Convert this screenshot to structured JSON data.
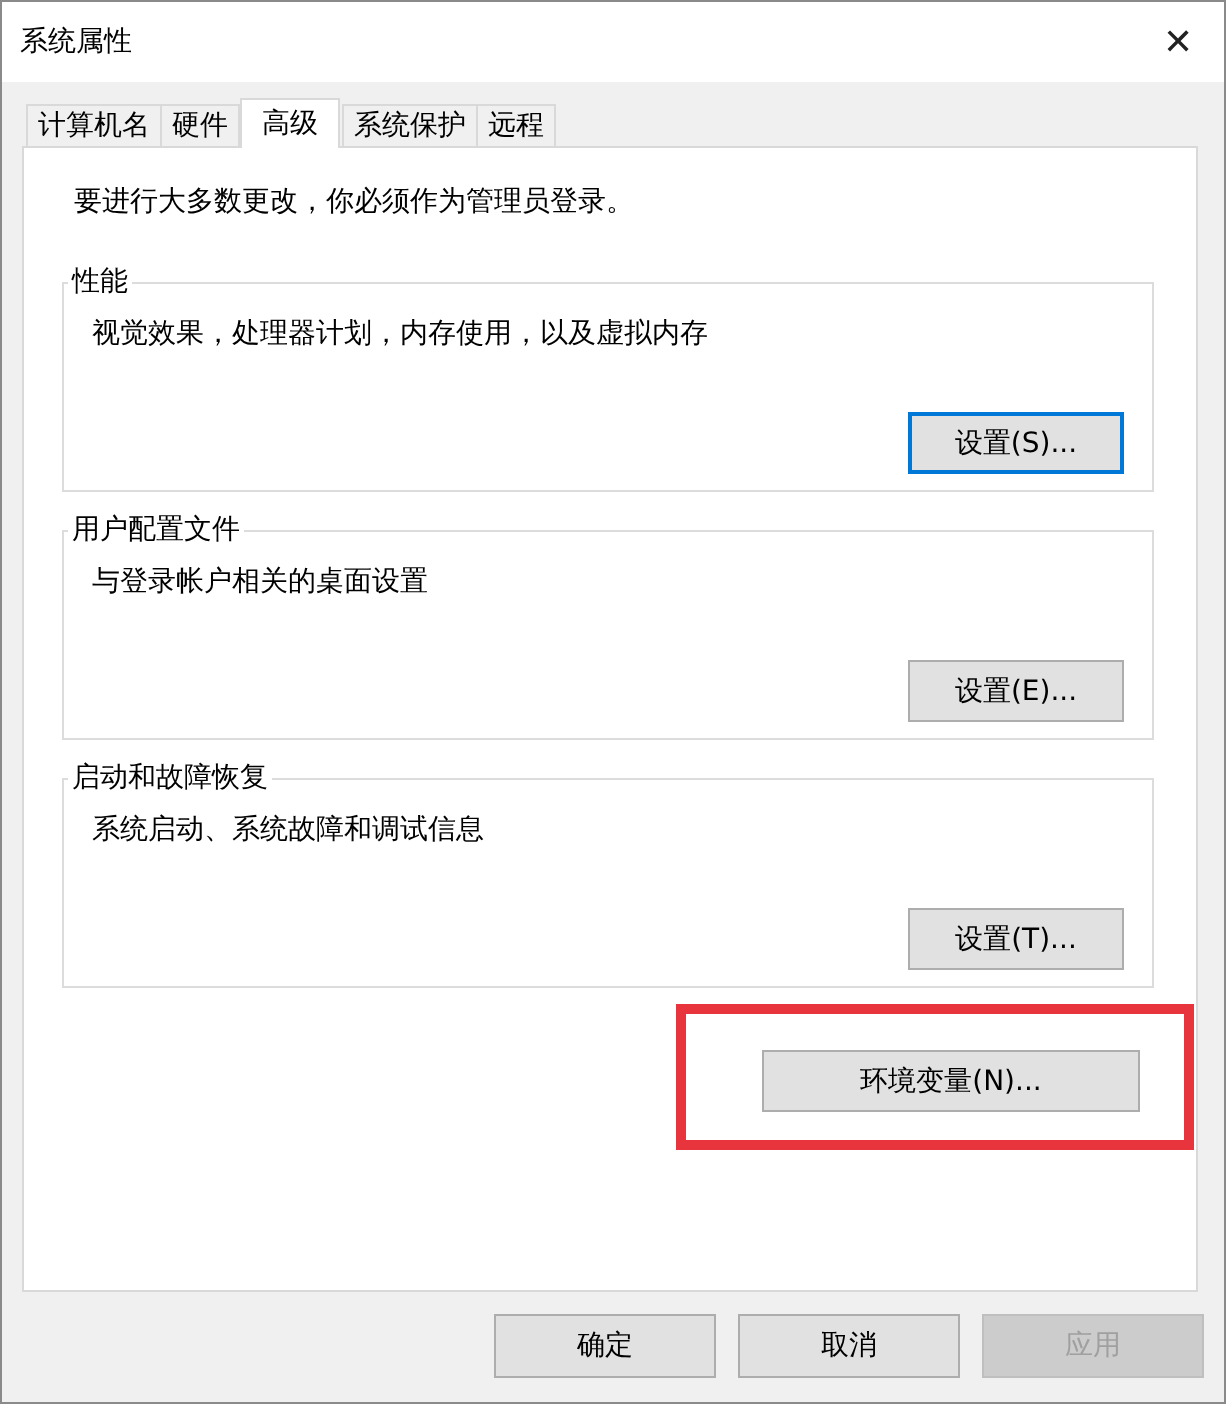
{
  "window": {
    "title": "系统属性",
    "close": "✕"
  },
  "tabs": [
    {
      "label": "计算机名",
      "selected": false
    },
    {
      "label": "硬件",
      "selected": false
    },
    {
      "label": "高级",
      "selected": true
    },
    {
      "label": "系统保护",
      "selected": false
    },
    {
      "label": "远程",
      "selected": false
    }
  ],
  "notice": "要进行大多数更改，你必须作为管理员登录。",
  "groups": [
    {
      "title": "性能",
      "description": "视觉效果，处理器计划，内存使用，以及虚拟内存",
      "button": "设置(S)...",
      "focused": true
    },
    {
      "title": "用户配置文件",
      "description": "与登录帐户相关的桌面设置",
      "button": "设置(E)...",
      "focused": false
    },
    {
      "title": "启动和故障恢复",
      "description": "系统启动、系统故障和调试信息",
      "button": "设置(T)...",
      "focused": false
    }
  ],
  "env_button": {
    "label": "环境变量(N)...",
    "highlighted": true
  },
  "buttons": [
    {
      "label": "确定",
      "disabled": false
    },
    {
      "label": "取消",
      "disabled": false
    },
    {
      "label": "应用",
      "disabled": true
    }
  ]
}
